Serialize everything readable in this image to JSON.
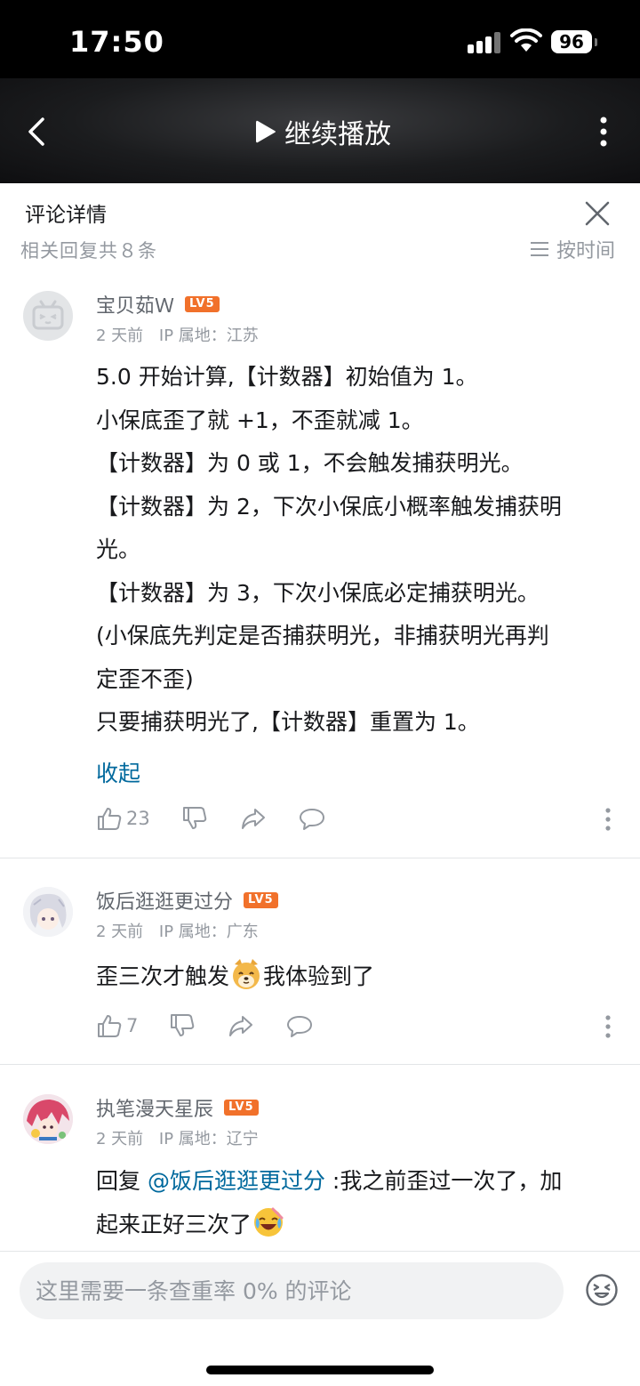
{
  "status_bar": {
    "time": "17:50",
    "battery": "96"
  },
  "video_bar": {
    "play_label": "继续播放"
  },
  "panel": {
    "title": "评论详情",
    "reply_count": "相关回复共８条",
    "sort_label": "按时间"
  },
  "comments": [
    {
      "username": "宝贝茹Ｗ",
      "level": "LV5",
      "time": "2 天前",
      "ip": "IP 属地：江苏",
      "lines": [
        "5.0 开始计算,【计数器】初始值为 1。",
        "小保底歪了就 +1，不歪就减 1。",
        "【计数器】为 0 或 1，不会触发捕获明光。",
        "【计数器】为 2，下次小保底小概率触发捕获明",
        "光。",
        "【计数器】为 3，下次小保底必定捕获明光。",
        "(小保底先判定是否捕获明光，非捕获明光再判",
        "定歪不歪)",
        "只要捕获明光了,【计数器】重置为 1。"
      ],
      "collapse_label": "收起",
      "likes": "23"
    },
    {
      "username": "饭后逛逛更过分",
      "level": "LV5",
      "time": "2 天前",
      "ip": "IP 属地：广东",
      "text_before": "歪三次才触发",
      "text_after": "我体验到了",
      "emoji": "doge-emoji",
      "likes": "7"
    },
    {
      "username": "执笔漫天星辰",
      "level": "LV5",
      "time": "2 天前",
      "ip": "IP 属地：辽宁",
      "reply_prefix": "回复",
      "mention": "@饭后逛逛更过分",
      "text_line1": " :我之前歪过一次了，加",
      "text_line2": "起来正好三次了",
      "emoji": "laugh-cry-emoji"
    }
  ],
  "input": {
    "placeholder": "这里需要一条查重率 0% 的评论"
  }
}
